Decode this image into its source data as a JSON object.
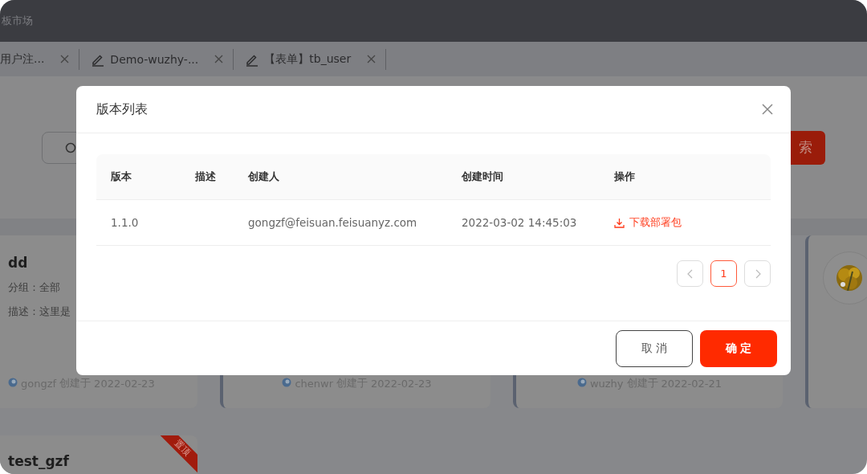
{
  "app_bar": {
    "title": "板市场"
  },
  "tabs": [
    {
      "label": "用户注...",
      "kind": "plain"
    },
    {
      "label": "Demo-wuzhy-...",
      "kind": "edit"
    },
    {
      "label": "【表单】tb_user",
      "kind": "edit"
    }
  ],
  "search": {
    "button": "索"
  },
  "cards": [
    {
      "kind": "info",
      "title": "dd",
      "group": "分组：全部",
      "description": "描述：这里是",
      "author": "gongzf",
      "created": "创建于",
      "date": "2022-02-23"
    },
    {
      "kind": "footer",
      "author": "chenwr",
      "created": "创建于",
      "date": "2022-02-23"
    },
    {
      "kind": "footer",
      "author": "wuzhy",
      "created": "创建于",
      "date": "2022-02-21"
    },
    {
      "kind": "avatar"
    }
  ],
  "cards_row_2": [
    {
      "title": "test_gzf",
      "ribbon": "置顶"
    }
  ],
  "dialog": {
    "title": "版本列表",
    "columns": [
      "版本",
      "描述",
      "创建人",
      "创建时间",
      "操作"
    ],
    "rows": [
      {
        "version": "1.1.0",
        "creator": "gongzf@feisuan.feisuanyz.com",
        "created_at": "2022-03-02 14:45:03",
        "action": "下载部署包"
      }
    ],
    "pages": [
      {
        "label": "1",
        "selected": true
      }
    ],
    "buttons": [
      {
        "label": "取 消",
        "kind": "default"
      },
      {
        "label": "确 定",
        "kind": "primary"
      }
    ]
  }
}
